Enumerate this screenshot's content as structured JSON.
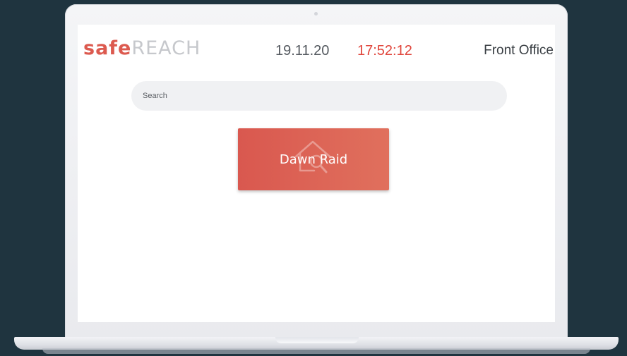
{
  "header": {
    "logo_part1": "safe",
    "logo_part2": "REACH",
    "date": "19.11.20",
    "time": "17:52:12",
    "location": "Front Office"
  },
  "search": {
    "placeholder": "Search",
    "value": ""
  },
  "tiles": [
    {
      "label": "Dawn Raid",
      "icon": "house-search-icon"
    }
  ],
  "colors": {
    "background": "#1f343f",
    "brand_red": "#dc5a4f",
    "time_red": "#e0463c",
    "tile_gradient_start": "#d9584f",
    "tile_gradient_end": "#e0705d"
  }
}
